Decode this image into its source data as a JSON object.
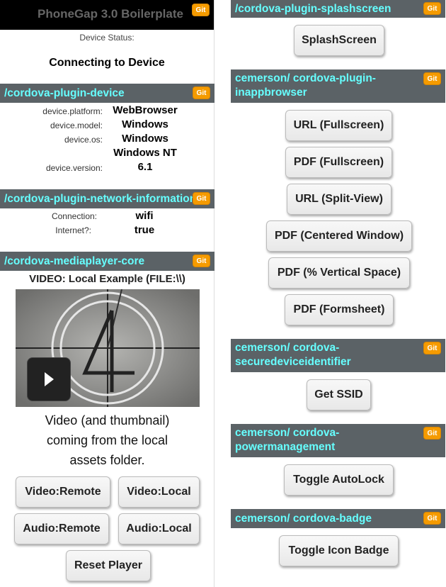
{
  "left": {
    "app_title": "PhoneGap 3.0 Boilerplate",
    "git_label": "Git",
    "device_status_label": "Device Status:",
    "device_status_value": "Connecting to Device",
    "device_section": "/cordova-plugin-device",
    "device": {
      "platform_label": "device.platform:",
      "platform_value": "WebBrowser",
      "model_label": "device.model:",
      "model_value": "Windows",
      "os_label": "device.os:",
      "os_value_1": "Windows",
      "os_value_2": "Windows NT",
      "version_label": "device.version:",
      "version_value": "6.1"
    },
    "network_section": "/cordova-plugin-network-information",
    "network": {
      "connection_label": "Connection:",
      "connection_value": "wifi",
      "internet_label": "Internet?:",
      "internet_value": "true"
    },
    "media_section": "/cordova-mediaplayer-core",
    "video_title": "VIDEO: Local Example (FILE:\\\\)",
    "caption": [
      "Video (and thumbnail)",
      "coming from the local",
      "assets folder."
    ],
    "buttons": {
      "video_remote": "Video:Remote",
      "video_local": "Video:Local",
      "audio_remote": "Audio:Remote",
      "audio_local": "Audio:Local",
      "reset": "Reset Player"
    }
  },
  "right": {
    "splash_section": "/cordova-plugin-splashscreen",
    "splash_button": "SplashScreen",
    "iab_section": "cemerson/ cordova-plugin-inappbrowser",
    "iab_buttons": [
      "URL (Fullscreen)",
      "PDF (Fullscreen)",
      "URL (Split-View)",
      "PDF (Centered Window)",
      "PDF (% Vertical Space)",
      "PDF (Formsheet)"
    ],
    "ssid_section": "cemerson/ cordova-securedeviceidentifier",
    "ssid_button": "Get SSID",
    "power_section": "cemerson/ cordova-powermanagement",
    "power_button": "Toggle AutoLock",
    "badge_section": "cemerson/ cordova-badge",
    "badge_button": "Toggle Icon Badge"
  },
  "colors": {
    "section_bg": "#5b6266",
    "section_text": "#66ffff",
    "git_badge": "#f59b00"
  }
}
